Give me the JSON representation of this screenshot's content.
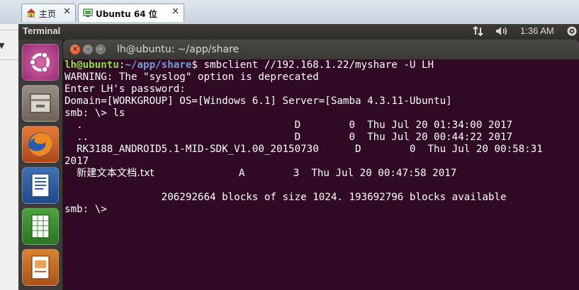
{
  "host_tabs": [
    {
      "label": "主页",
      "icon": "home-icon"
    },
    {
      "label": "Ubuntu 64 位",
      "icon": "vm-icon"
    }
  ],
  "panel": {
    "app_title": "Terminal",
    "clock": "1:36 AM"
  },
  "launcher": {
    "items": [
      "ubuntu-dash-icon",
      "file-manager-icon",
      "firefox-icon",
      "writer-icon",
      "calc-icon",
      "impress-icon"
    ]
  },
  "terminal": {
    "window_title": "lh@ubuntu: ~/app/share",
    "prompt_user": "lh@ubuntu",
    "prompt_path": "~/app/share",
    "command": "$ smbclient //192.168.1.22/myshare -U LH",
    "lines": [
      "WARNING: The \"syslog\" option is deprecated",
      "Enter LH's password:",
      "Domain=[WORKGROUP] OS=[Windows 6.1] Server=[Samba 4.3.11-Ubuntu]",
      "smb: \\> ls",
      "  .                                   D        0  Thu Jul 20 01:34:00 2017",
      "  ..                                  D        0  Thu Jul 20 00:44:22 2017",
      "  RK3188_ANDROID5.1-MID-SDK_V1.00_20150730      D        0  Thu Jul 20 00:58:31",
      "2017",
      "",
      "",
      "                206292664 blocks of size 1024. 193692796 blocks available",
      "smb: \\>"
    ],
    "cjk_file_name": "新建文本文档.txt",
    "cjk_file_rest": "              A        3  Thu Jul 20 00:47:58 2017"
  }
}
